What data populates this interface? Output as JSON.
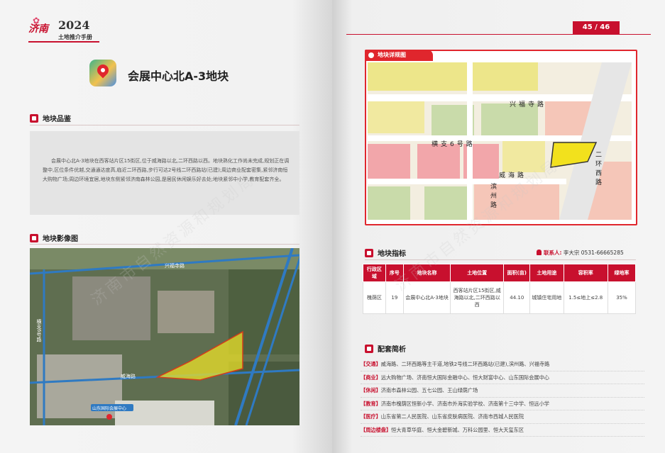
{
  "left_page": {
    "brand": {
      "mark": "济南",
      "year": "2024",
      "subtitle": "土地推介手册"
    },
    "title": "会展中心北A-3地块",
    "section_quality": {
      "label": "地块品鉴"
    },
    "description": "会展中心北A-3地块在西客站片区15街区,位于威海路以北,二环西路以西。地块熟化工作尚未完成,规划正在调整中,区位条件优越,交通通达度高,临近二环西路,步行可达2号线二环西路站(已建);周边商业配套密集,紧邻济南恒大购物广场;周边环境宜居,地块东侧紧邻济南森林公园,是居民休闲娱乐好去处;地块紧邻中小学,教育配套齐全。",
    "section_photo": {
      "label": "地块影像图"
    },
    "photo_labels": {
      "road_top": "兴福寺路",
      "road_left": "横支6号路",
      "road_bottom": "威海路",
      "marker": "山东国际会展中心"
    }
  },
  "right_page": {
    "page_number": "45 / 46",
    "map_section": {
      "label": "地块详规图"
    },
    "map_labels": {
      "road_1": "兴福寺路",
      "road_2": "横支6号路",
      "road_3": "威海路",
      "road_4": "滨州路",
      "road_5": "二环西路"
    },
    "index_section": {
      "label": "地块指标"
    },
    "contact": {
      "label": "联系人:",
      "value": "李大宗 0531-66665285"
    },
    "table": {
      "headers": [
        "行政区域",
        "序号",
        "地块名称",
        "土地位置",
        "面积(亩)",
        "土地用途",
        "容积率",
        "绿地率"
      ],
      "row": [
        "槐荫区",
        "19",
        "会展中心北A-3地块",
        "西客站片区15街区,威海路以北,二环西路以西",
        "44.10",
        "城镇住宅用地",
        "1.5≤地上≤2.8",
        "35%"
      ]
    },
    "match_section": {
      "label": "配套简析"
    },
    "match_items": [
      {
        "tag": "【交通】",
        "text": "威海路、二环西路等主干道,地铁2号线二环西路站(已建),滨州路、兴福寺路"
      },
      {
        "tag": "【商业】",
        "text": "远大购物广场、济南恒大国际金融中心、恒大财富中心、山东国际会展中心"
      },
      {
        "tag": "【休闲】",
        "text": "济南市森林公园、五七公园、王山绿荫广场"
      },
      {
        "tag": "【教育】",
        "text": "济南市槐荫区恒新小学、济南市外海实验学校、济南第十三中学、恒远小学"
      },
      {
        "tag": "【医疗】",
        "text": "山东省第二人民医院、山东省皮肤病医院、济南市西城人民医院"
      },
      {
        "tag": "【周边楼盘】",
        "text": "恒大青草华庭、恒大金碧新城、万科公园里、恒大天玺东区"
      }
    ]
  },
  "watermark": "济南市自然资源和规划局",
  "colors": {
    "brand_red": "#c8102e",
    "parcel_yellow": "#f2e11d"
  }
}
